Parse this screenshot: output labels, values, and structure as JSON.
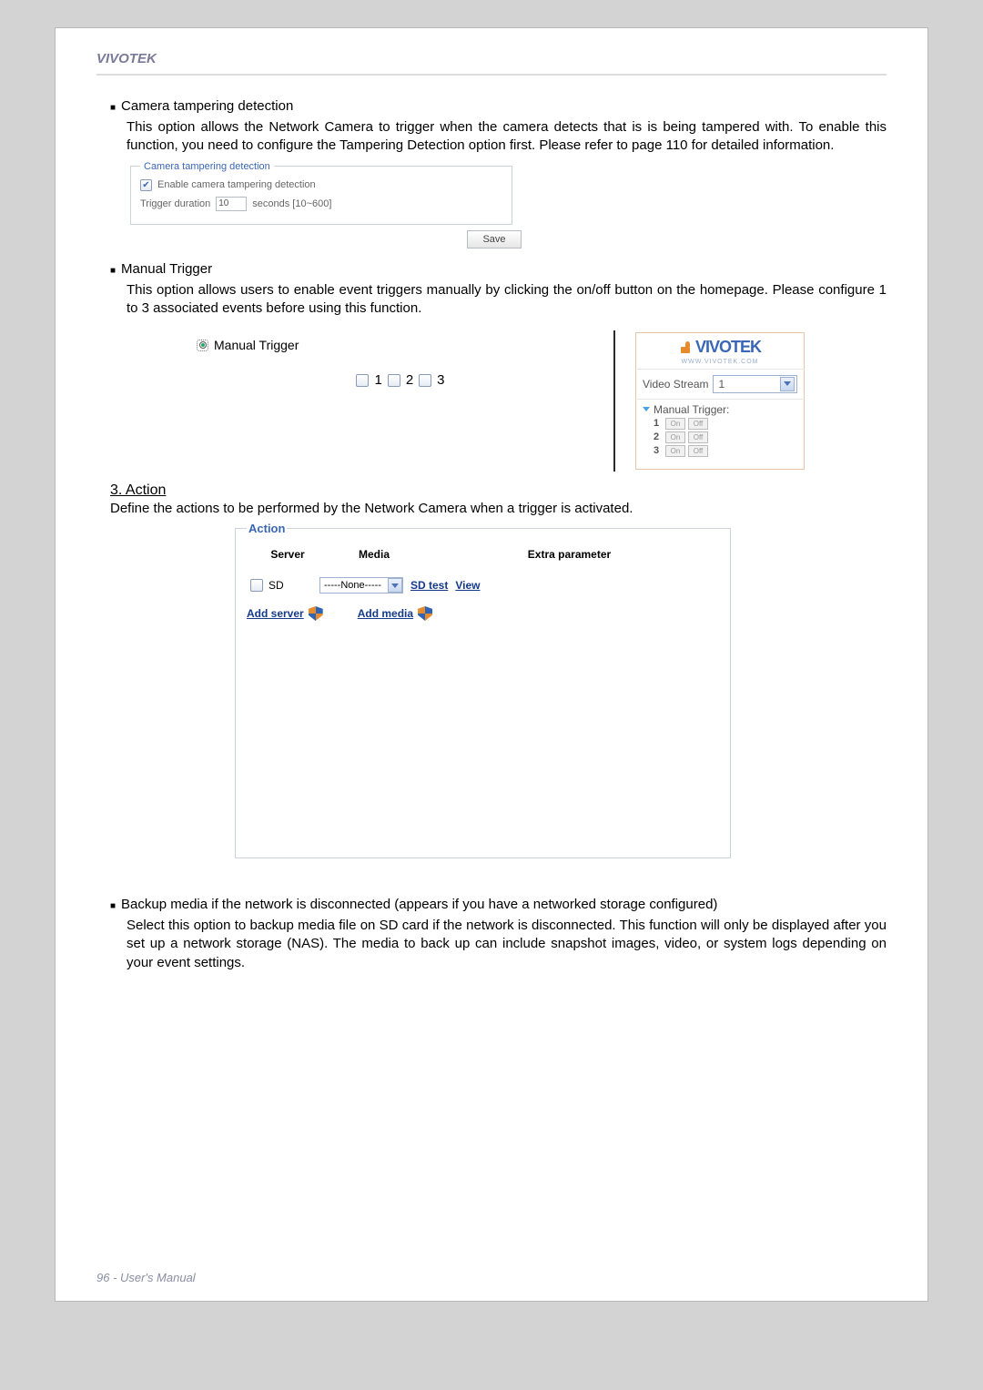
{
  "header": {
    "brand": "VIVOTEK"
  },
  "tampering": {
    "title": "Camera tampering detection",
    "desc": "This option allows the Network Camera to trigger when the camera detects that is is being tampered with. To enable this function, you need to configure the Tampering Detection option first. Please refer to page 110 for detailed information.",
    "fs_title": "Camera tampering detection",
    "enable_label": "Enable camera tampering detection",
    "duration_label": "Trigger duration",
    "duration_value": "10",
    "duration_hint": "seconds [10~600]",
    "save": "Save"
  },
  "manual": {
    "title": "Manual Trigger",
    "desc": "This option allows users to enable event triggers manually by clicking the on/off button on the homepage. Please configure 1 to 3 associated events before using this function.",
    "radio_label": "Manual Trigger",
    "opts": [
      "1",
      "2",
      "3"
    ]
  },
  "side": {
    "logo": "VIVOTEK",
    "url": "WWW.VIVOTEK.COM",
    "vs_label": "Video Stream",
    "vs_value": "1",
    "title": "Manual Trigger:",
    "triggers": [
      {
        "num": "1",
        "on": "On",
        "off": "Off"
      },
      {
        "num": "2",
        "on": "On",
        "off": "Off"
      },
      {
        "num": "3",
        "on": "On",
        "off": "Off"
      }
    ]
  },
  "action": {
    "heading": "3. Action",
    "desc": "Define the actions to be performed by the Network Camera when a trigger is activated.",
    "fs_title": "Action",
    "headers": {
      "server": "Server",
      "media": "Media",
      "extra": "Extra parameter"
    },
    "row": {
      "sd": "SD",
      "none": "-----None-----",
      "sdtest": "SD test",
      "view": "View"
    },
    "add_server": "Add server",
    "add_media": "Add media"
  },
  "backup": {
    "title": "Backup media if the network is disconnected (appears if you have a networked storage configured)",
    "desc": "Select this option to backup media file on SD card if the network is disconnected. This function will only be displayed after you set up a network storage (NAS). The media to back up can include snapshot images, video, or system logs depending on your event settings."
  },
  "footer": {
    "page": "96 - User's Manual"
  }
}
